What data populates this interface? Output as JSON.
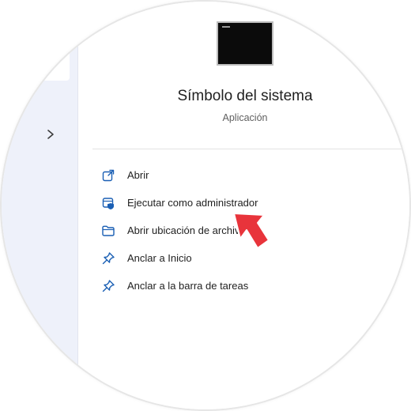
{
  "app": {
    "title": "Símbolo del sistema",
    "subtitle": "Aplicación",
    "thumbnail_icon": "terminal-window-icon"
  },
  "sidebar": {
    "expand_icon": "chevron-right-icon"
  },
  "menu": {
    "items": [
      {
        "label": "Abrir",
        "icon": "open-external-icon"
      },
      {
        "label": "Ejecutar como administrador",
        "icon": "run-as-admin-shield-icon"
      },
      {
        "label": "Abrir ubicación de archivo",
        "icon": "folder-icon"
      },
      {
        "label": "Anclar a Inicio",
        "icon": "pin-icon"
      },
      {
        "label": "Anclar a la barra de tareas",
        "icon": "pin-icon"
      }
    ]
  },
  "annotation": {
    "icon": "red-arrow-pointer-icon",
    "color": "#e8343b"
  },
  "colors": {
    "accent": "#1a5fb4",
    "sidebar_bg": "#eef1fa",
    "text": "#1f1f1f",
    "subtext": "#5f5f5f"
  }
}
